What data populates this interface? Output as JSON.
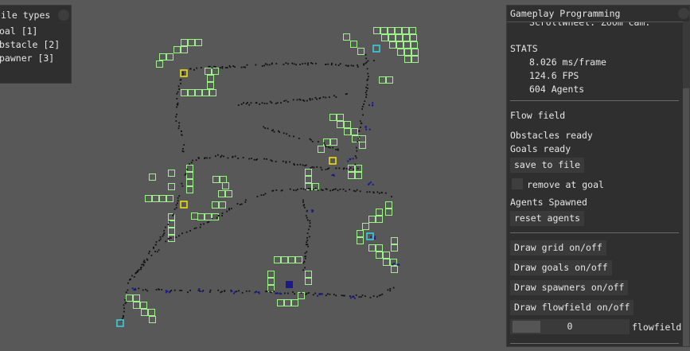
{
  "tile_types_panel": {
    "title": "ile types",
    "items": [
      {
        "label": "oal [1]"
      },
      {
        "label": "bstacle [2]"
      },
      {
        "label": "pawner [3]"
      }
    ]
  },
  "gameplay_panel": {
    "title": "Gameplay Programming",
    "scroll_hint": "ScrollWheel: Zoom cam.",
    "stats": {
      "title": "STATS",
      "ms_per_frame": "8.026 ms/frame",
      "fps": "124.6 FPS",
      "agents": "604 Agents"
    },
    "flow_field": {
      "title": "Flow field",
      "obstacles_status": "Obstacles ready",
      "goals_status": "Goals ready",
      "save_button": "save to file",
      "remove_at_goal_label": "remove at goal",
      "agents_status": "Agents Spawned",
      "reset_button": "reset agents"
    },
    "draw_buttons": {
      "grid": "Draw grid on/off",
      "goals": "Draw goals on/off",
      "spawners": "Draw spawners on/off",
      "flowfield": "Draw flowfield on/off"
    },
    "slider": {
      "value": "0",
      "label": "flowfield"
    }
  },
  "colors": {
    "background": "#585858",
    "obstacle_fill": "#5a5a5a",
    "obstacle_stroke": "#9df28a",
    "goal": "#f5e50a",
    "spawner": "#39d5e8",
    "agent_dark": "#111111",
    "agent_blue": "#1a1a8a"
  }
}
